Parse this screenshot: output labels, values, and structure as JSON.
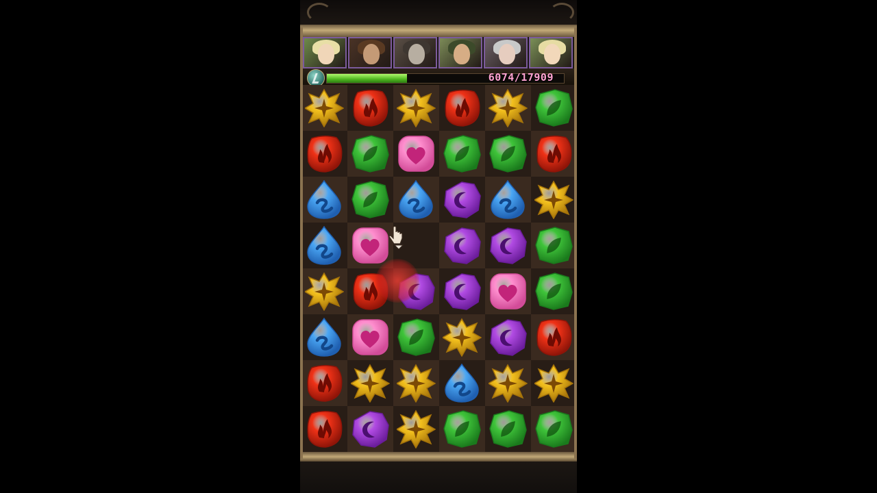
{
  "hp": {
    "current": 6074,
    "max": 17909,
    "text": "6074/17909",
    "fraction": 0.339
  },
  "team": [
    {
      "name": "leader-elf",
      "bg": "#6e8a4a",
      "face": "#f0d6b8",
      "hair": "#e8dfa6"
    },
    {
      "name": "warrior",
      "bg": "#4a3326",
      "face": "#c49a76",
      "hair": "#5a3a22"
    },
    {
      "name": "dark-knight",
      "bg": "#5a4f46",
      "face": "#b7aea1",
      "hair": "#3e3731"
    },
    {
      "name": "earth-brawler",
      "bg": "#7b8a57",
      "face": "#d6ad85",
      "hair": "#3c4a2a"
    },
    {
      "name": "silver-mage",
      "bg": "#6b5f66",
      "face": "#e6cdbf",
      "hair": "#c8c9c9"
    },
    {
      "name": "friend-elf",
      "bg": "#7a8f57",
      "face": "#f2d8ba",
      "hair": "#e6dca3"
    }
  ],
  "orb_colors": {
    "light": {
      "base": "#f3c01d",
      "dark": "#a5730a",
      "mark": "#7c4a05"
    },
    "fire": {
      "base": "#f03217",
      "dark": "#8e1408",
      "mark": "#6e0b03"
    },
    "wood": {
      "base": "#3fc43a",
      "dark": "#1a7a1c",
      "mark": "#10520f"
    },
    "heart": {
      "base": "#ff8fcf",
      "dark": "#d24c98",
      "mark": "#c2247a"
    },
    "water": {
      "base": "#4aa6f4",
      "dark": "#1f5fb0",
      "mark": "#12478a"
    },
    "dark": {
      "base": "#b14be3",
      "dark": "#6a1c9a",
      "mark": "#4b0f6f"
    }
  },
  "board": [
    [
      "light",
      "fire",
      "light",
      "fire",
      "light",
      "wood"
    ],
    [
      "fire",
      "wood",
      "heart",
      "wood",
      "wood",
      "fire"
    ],
    [
      "water",
      "wood",
      "water",
      "dark",
      "water",
      "light"
    ],
    [
      "water",
      "heart",
      "",
      "dark",
      "dark",
      "wood"
    ],
    [
      "light",
      "fire",
      "dark",
      "dark",
      "heart",
      "wood"
    ],
    [
      "water",
      "heart",
      "wood",
      "light",
      "dark",
      "fire"
    ],
    [
      "fire",
      "light",
      "light",
      "water",
      "light",
      "light"
    ],
    [
      "fire",
      "dark",
      "light",
      "wood",
      "wood",
      "wood"
    ]
  ],
  "held_orb": "fire"
}
